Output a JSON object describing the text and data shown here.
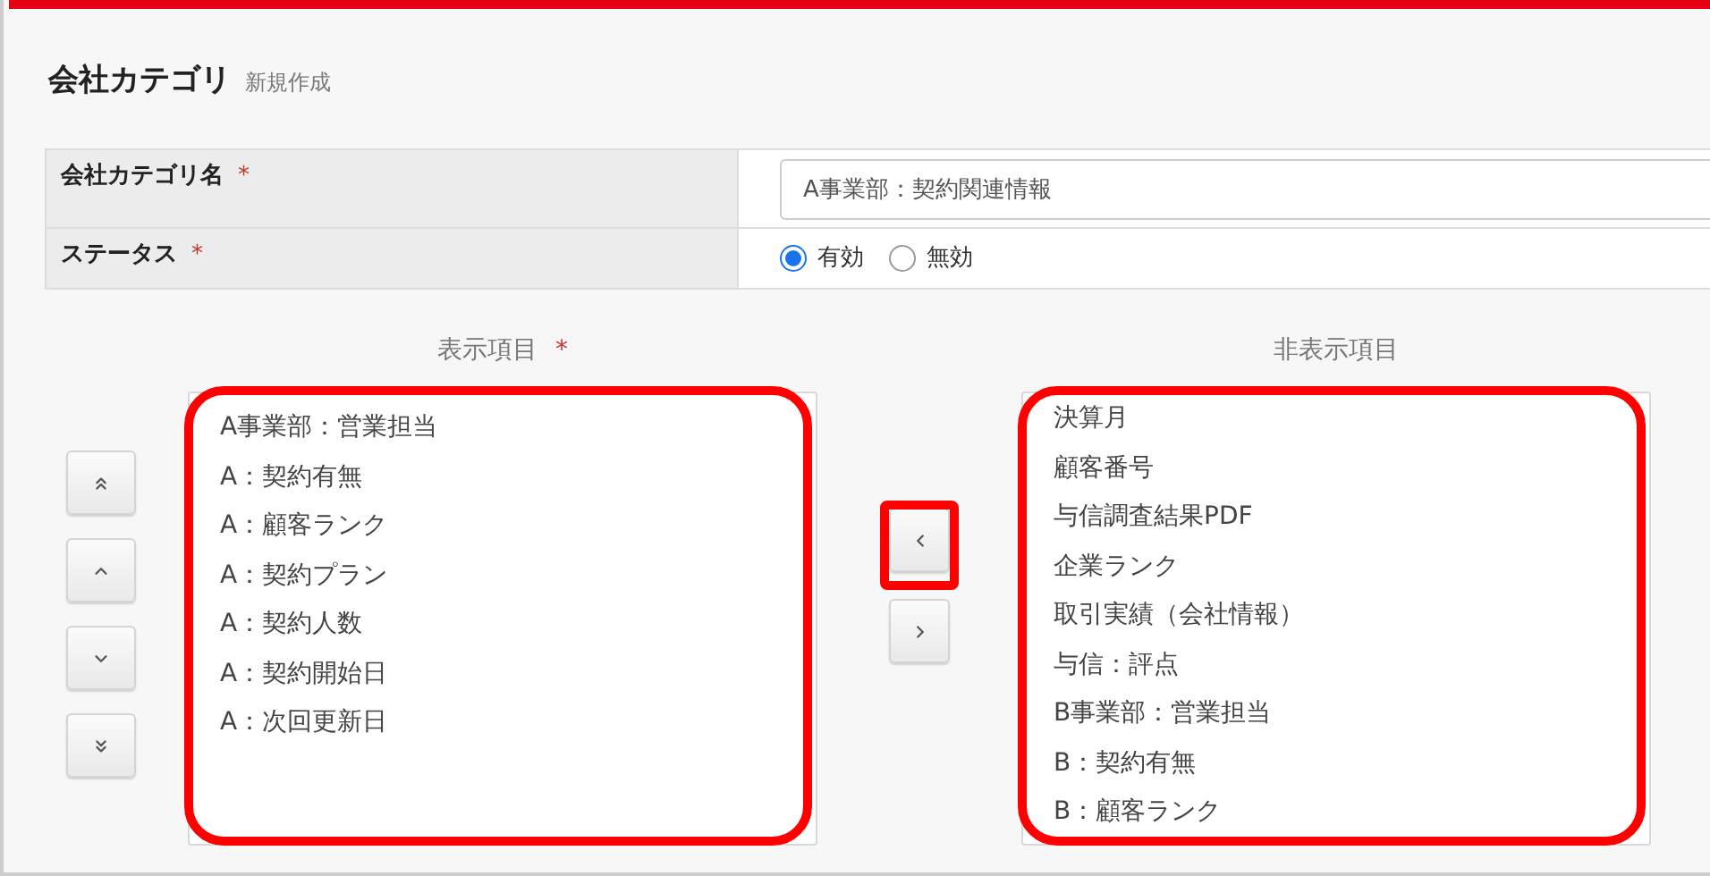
{
  "header": {
    "title": "会社カテゴリ",
    "subtitle": "新規作成"
  },
  "form": [
    {
      "kind": "input",
      "label": "会社カテゴリ名",
      "required_mark": "*",
      "value": "A事業部：契約関連情報"
    },
    {
      "kind": "radio",
      "label": "ステータス",
      "required_mark": "*",
      "options": [
        {
          "label": "有効",
          "selected": true
        },
        {
          "label": "無効",
          "selected": false
        }
      ]
    }
  ],
  "move_buttons": [
    {
      "kind": "top"
    },
    {
      "kind": "up"
    },
    {
      "kind": "down"
    },
    {
      "kind": "bottom"
    }
  ],
  "shown_list": {
    "title": "表示項目",
    "required_mark": "*",
    "highlighted": true,
    "items": [
      "A事業部：営業担当",
      "A：契約有無",
      "A：顧客ランク",
      "A：契約プラン",
      "A：契約人数",
      "A：契約開始日",
      "A：次回更新日"
    ]
  },
  "transfer_buttons": [
    {
      "kind": "left",
      "highlighted": true
    },
    {
      "kind": "right",
      "highlighted": false
    }
  ],
  "hidden_list": {
    "title": "非表示項目",
    "highlighted": true,
    "items": [
      "決算月",
      "顧客番号",
      "与信調査結果PDF",
      "企業ランク",
      "取引実績（会社情報）",
      "与信：評点",
      "B事業部：営業担当",
      "B：契約有無",
      "B：顧客ランク"
    ]
  }
}
